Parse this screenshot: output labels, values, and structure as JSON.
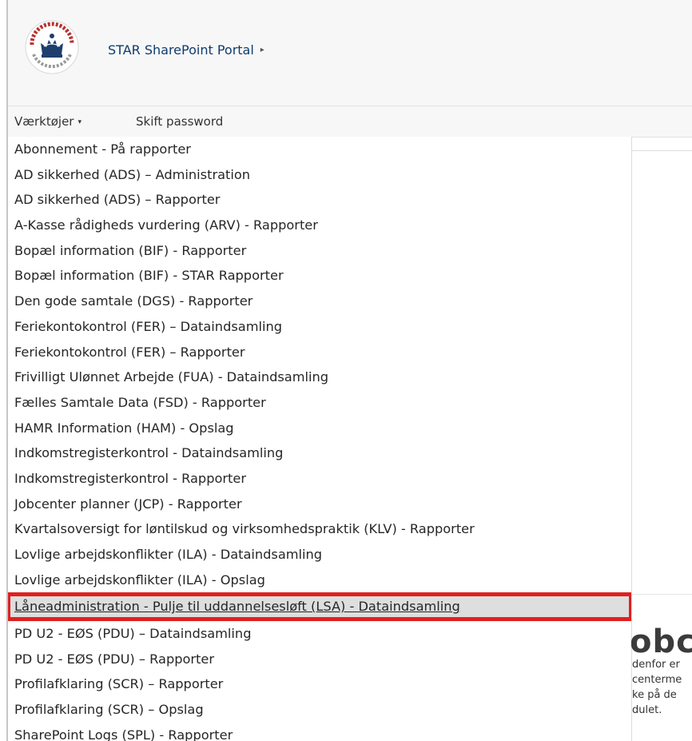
{
  "header": {
    "logo_ring_text": "ARBEJDSMARKED REKRUTTERING",
    "site_title": "STAR SharePoint Portal",
    "breadcrumb_arrow": "▸"
  },
  "toolbar": {
    "tools_label": "Værktøjer",
    "tools_caret": "▾",
    "change_password_label": "Skift password"
  },
  "menu": {
    "items": [
      "Abonnement - På rapporter",
      "AD sikkerhed (ADS) – Administration",
      "AD sikkerhed (ADS) – Rapporter",
      "A-Kasse rådigheds vurdering (ARV) - Rapporter",
      "Bopæl information (BIF) - Rapporter",
      "Bopæl information (BIF) - STAR Rapporter",
      "Den gode samtale (DGS) - Rapporter",
      "Feriekontokontrol (FER) – Dataindsamling",
      "Feriekontokontrol (FER) – Rapporter",
      "Frivilligt Ulønnet Arbejde (FUA) - Dataindsamling",
      "Fælles Samtale Data (FSD) - Rapporter",
      "HAMR Information (HAM) - Opslag",
      "Indkomstregisterkontrol - Dataindsamling",
      "Indkomstregisterkontrol - Rapporter",
      "Jobcenter planner (JCP) - Rapporter",
      "Kvartalsoversigt for løntilskud og virksomhedspraktik (KLV) - Rapporter",
      "Lovlige arbejdskonflikter (ILA) - Dataindsamling",
      "Lovlige arbejdskonflikter (ILA) - Opslag",
      "Låneadministration - Pulje til uddannelsesløft (LSA) - Dataindsamling",
      "PD U2 - EØS (PDU) – Dataindsamling",
      "PD U2 - EØS (PDU) – Rapporter",
      "Profilafklaring (SCR) – Rapporter",
      "Profilafklaring (SCR) – Opslag",
      "SharePoint Logs (SPL) - Rapporter"
    ],
    "highlighted_index": 18
  },
  "background_content": {
    "heading_fragment": "obc",
    "lines": [
      "denfor er",
      "centerme",
      "ke på de",
      "dulet."
    ]
  },
  "colors": {
    "highlight_border": "#e02020",
    "highlight_fill": "#dedede",
    "title_blue": "#0f3c6e"
  }
}
